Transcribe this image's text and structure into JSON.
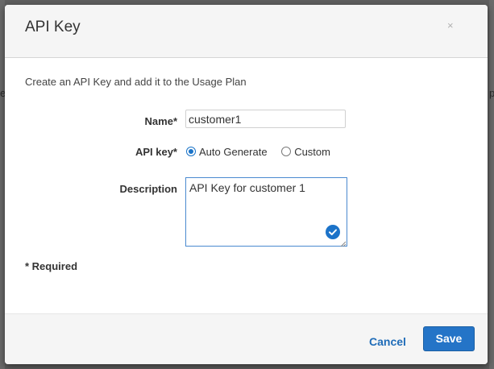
{
  "dialog": {
    "title": "API Key",
    "close_glyph": "×",
    "intro": "Create an API Key and add it to the Usage Plan"
  },
  "form": {
    "name_label": "Name*",
    "name_value": "customer1",
    "apikey_label": "API key*",
    "apikey_options": [
      {
        "label": "Auto Generate",
        "selected": true
      },
      {
        "label": "Custom",
        "selected": false
      }
    ],
    "description_label": "Description",
    "description_value": "API Key for customer 1",
    "required_note": "* Required"
  },
  "footer": {
    "cancel_label": "Cancel",
    "save_label": "Save"
  },
  "background": {
    "left_edge_text": "e",
    "right_edge_text": "po"
  },
  "icons": {
    "close": "close-icon",
    "validation": "checkmark-badge-icon",
    "resize": "resize-grip-icon"
  },
  "colors": {
    "accent": "#2474c7",
    "link": "#1f6cb8",
    "overlay": "#5f5f5f"
  }
}
